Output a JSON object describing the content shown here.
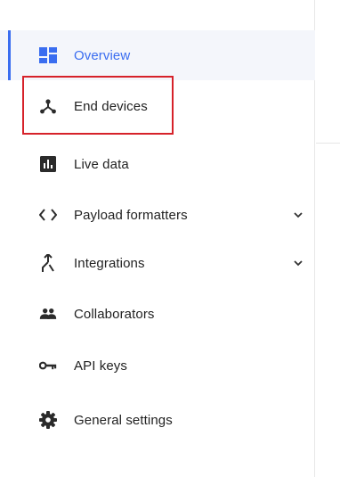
{
  "colors": {
    "accent": "#3a6df0",
    "text": "#222222",
    "icon": "#2b2b2b",
    "highlight": "#d6222a"
  },
  "sidebar": {
    "items": [
      {
        "label": "Overview",
        "icon": "dashboard-icon",
        "active": true
      },
      {
        "label": "End devices",
        "icon": "devices-hub-icon",
        "highlighted": true
      },
      {
        "label": "Live data",
        "icon": "bar-chart-icon"
      },
      {
        "label": "Payload formatters",
        "icon": "code-icon",
        "expandable": true
      },
      {
        "label": "Integrations",
        "icon": "merge-icon",
        "expandable": true
      },
      {
        "label": "Collaborators",
        "icon": "people-icon"
      },
      {
        "label": "API keys",
        "icon": "key-icon"
      },
      {
        "label": "General settings",
        "icon": "gear-icon"
      }
    ]
  }
}
